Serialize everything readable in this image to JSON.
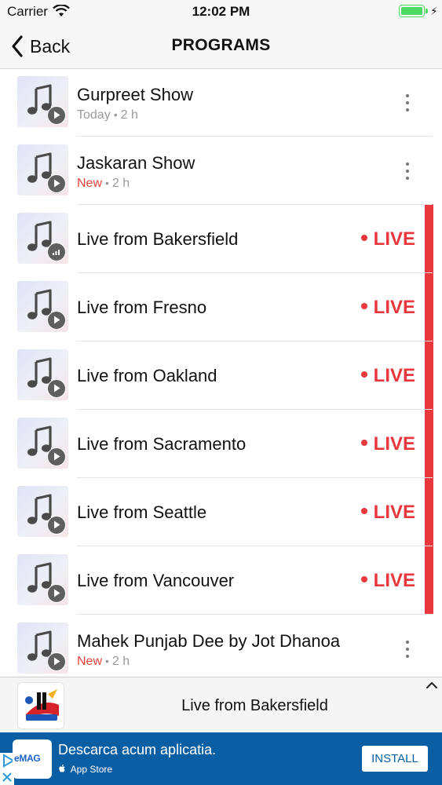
{
  "status_bar": {
    "carrier": "Carrier",
    "time": "12:02 PM",
    "battery_percent": 100,
    "battery_color": "#4cd964"
  },
  "nav": {
    "back_label": "Back",
    "title": "PROGRAMS"
  },
  "programs": [
    {
      "title": "Gurpreet Show",
      "status": "Today",
      "duration": "2 h",
      "badge_icon": "play-icon",
      "action_icon": "more-icon"
    },
    {
      "title": "Jaskaran Show",
      "status": "New",
      "duration": "2 h",
      "badge_icon": "play-icon",
      "action_icon": "more-icon"
    },
    {
      "title": "Live from Bakersfield",
      "live_label": "LIVE",
      "badge_icon": "signal-bars-icon"
    },
    {
      "title": "Live from Fresno",
      "live_label": "LIVE",
      "badge_icon": "play-icon"
    },
    {
      "title": "Live from Oakland",
      "live_label": "LIVE",
      "badge_icon": "play-icon"
    },
    {
      "title": "Live from Sacramento",
      "live_label": "LIVE",
      "badge_icon": "play-icon"
    },
    {
      "title": "Live from Seattle",
      "live_label": "LIVE",
      "badge_icon": "play-icon"
    },
    {
      "title": "Live from Vancouver",
      "live_label": "LIVE",
      "badge_icon": "play-icon"
    },
    {
      "title": "Mahek Punjab Dee by Jot Dhanoa",
      "status": "New",
      "duration": "2 h",
      "badge_icon": "play-icon",
      "action_icon": "more-icon"
    }
  ],
  "separator_dot": "•",
  "player": {
    "now_playing": "Live from Bakersfield",
    "logo_icon": "station-logo-icon",
    "expand_icon": "chevron-up-icon"
  },
  "ad": {
    "brand": "eMAG",
    "message": "Descarca acum aplicatia.",
    "store": "App Store",
    "install_label": "INSTALL"
  },
  "colors": {
    "live": "#e8383d",
    "new": "#e5443c",
    "ad_background": "#0a5fa4"
  }
}
